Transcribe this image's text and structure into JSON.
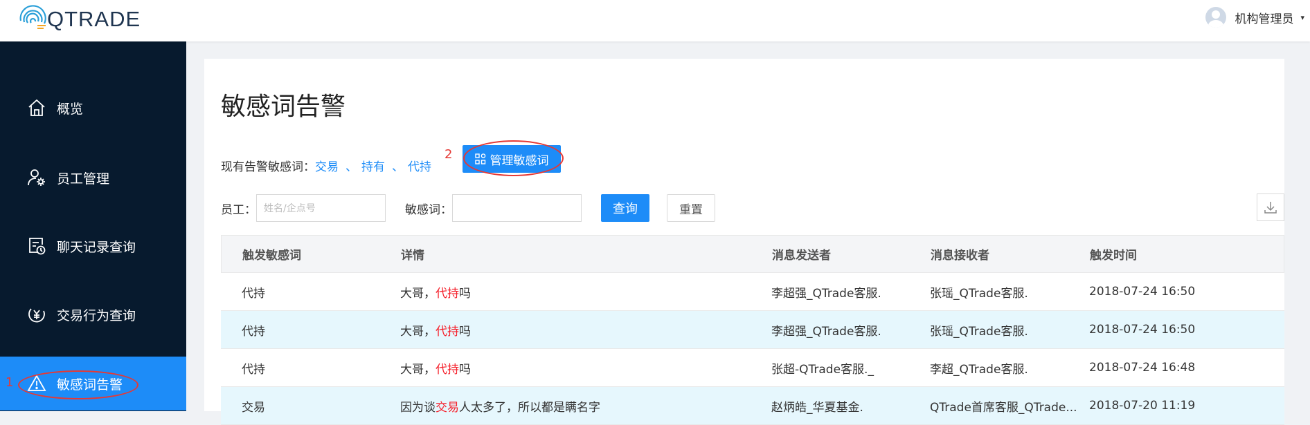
{
  "header": {
    "logo_text": "QTRADE",
    "user_name": "机构管理员",
    "caret": "▾"
  },
  "sidebar": {
    "items": [
      {
        "label": "概览",
        "icon": "home-icon"
      },
      {
        "label": "员工管理",
        "icon": "user-settings-icon"
      },
      {
        "label": "聊天记录查询",
        "icon": "chat-history-icon"
      },
      {
        "label": "交易行为查询",
        "icon": "yen-coin-icon"
      },
      {
        "label": "敏感词告警",
        "icon": "warning-icon",
        "active": true
      }
    ]
  },
  "annotations": {
    "n1": "1",
    "n2": "2"
  },
  "page": {
    "title": "敏感词告警",
    "words_label": "现有告警敏感词：",
    "words": [
      "交易",
      "持有",
      "代持"
    ],
    "word_sep": "、",
    "manage_button": "管理敏感词"
  },
  "filters": {
    "employee_label": "员工：",
    "employee_placeholder": "姓名/企点号",
    "word_label": "敏感词：",
    "word_value": "",
    "search_button": "查询",
    "reset_button": "重置"
  },
  "table": {
    "columns": [
      "触发敏感词",
      "详情",
      "消息发送者",
      "消息接收者",
      "触发时间"
    ],
    "rows": [
      {
        "word": "代持",
        "detail_pre": "大哥，",
        "detail_hl": "代持",
        "detail_post": "吗",
        "sender": "李超强_QTrade客服.",
        "receiver": "张瑶_QTrade客服.",
        "time": "2018-07-24 16:50"
      },
      {
        "word": "代持",
        "detail_pre": "大哥，",
        "detail_hl": "代持",
        "detail_post": "吗",
        "sender": "李超强_QTrade客服.",
        "receiver": "张瑶_QTrade客服.",
        "time": "2018-07-24 16:50"
      },
      {
        "word": "代持",
        "detail_pre": "大哥，",
        "detail_hl": "代持",
        "detail_post": "吗",
        "sender": "张超-QTrade客服._",
        "receiver": "李超_QTrade客服.",
        "time": "2018-07-24 16:48"
      },
      {
        "word": "交易",
        "detail_pre": "因为谈",
        "detail_hl": "交易",
        "detail_post": "人太多了，所以都是瞒名字",
        "sender": "赵炳皓_华夏基金.",
        "receiver": "QTrade首席客服_QTrade...",
        "time": "2018-07-20 11:19"
      }
    ]
  },
  "colors": {
    "accent": "#1d8cf8",
    "sidebar": "#071a2e",
    "highlight": "#f5222d",
    "annotation": "#e53935",
    "row_alt": "#e6f7fd"
  }
}
